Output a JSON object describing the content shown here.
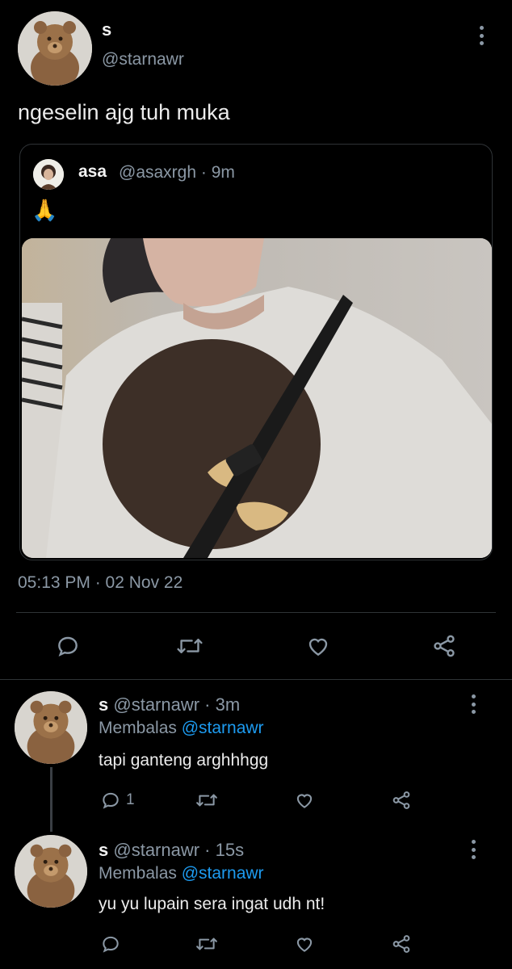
{
  "main_tweet": {
    "author_name": "s",
    "author_handle": "@starnawr",
    "text": "ngeselin ajg tuh muka",
    "avatar_icon": "teddy-bear-avatar",
    "quote": {
      "author_name": "asa",
      "meta": "@asaxrgh · 9m",
      "text": "🙏",
      "avatar_icon": "person-avatar",
      "photo_icon": "photo-person-white-tshirt"
    },
    "timestamp": "05:13 PM · 02 Nov 22",
    "actions": {
      "reply_icon": "reply-icon",
      "retweet_icon": "retweet-icon",
      "like_icon": "like-icon",
      "share_icon": "share-icon"
    }
  },
  "replies": [
    {
      "name": "s",
      "handle_time": "@starnawr · 3m",
      "replying_prefix": "Membalas ",
      "replying_to": "@starnawr",
      "text": "tapi ganteng arghhhgg",
      "reply_count": "1"
    },
    {
      "name": "s",
      "handle_time": "@starnawr · 15s",
      "replying_prefix": "Membalas ",
      "replying_to": "@starnawr",
      "text": "yu yu lupain sera ingat udh nt!",
      "reply_count": ""
    }
  ],
  "colors": {
    "background": "#000000",
    "text_primary": "#e7e9ea",
    "text_secondary": "#8b98a5",
    "link": "#1d9bf0",
    "border": "#2f3336"
  }
}
